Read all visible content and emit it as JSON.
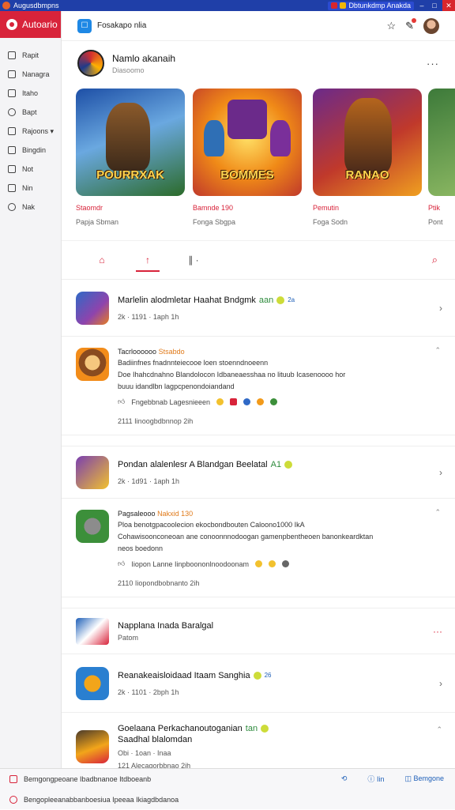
{
  "titlebar": {
    "title": "Augusdbmpns",
    "pill_text": "Dbtunkdmp Anakda"
  },
  "sidebar": {
    "brand": "Autoario",
    "items": [
      {
        "label": "Rapit",
        "icon": "square-icon"
      },
      {
        "label": "Nanagra",
        "icon": "inbox-icon"
      },
      {
        "label": "Itaho",
        "icon": "list-icon"
      },
      {
        "label": "Bapt",
        "icon": "tag-icon"
      },
      {
        "label": "Rajoons ▾",
        "icon": "play-icon"
      },
      {
        "label": "Bingdin",
        "icon": "doc-icon"
      },
      {
        "label": "Not",
        "icon": "calendar-icon"
      },
      {
        "label": "Nin",
        "icon": "mail-icon"
      },
      {
        "label": "Nak",
        "icon": "clock-icon"
      }
    ]
  },
  "topbar": {
    "app_name": "Fosakapo nlia"
  },
  "profile": {
    "name": "Namlo akanaih",
    "subtitle": "Diasoomo"
  },
  "carousel": [
    {
      "art_text": "POURRXAK",
      "title": "Staomdr",
      "subtitle": "Papja Sbman",
      "accent": "#1d4fa6"
    },
    {
      "art_text": "BOMMES",
      "title": "Bamnde 190",
      "subtitle": "Fonga Sbgpa",
      "accent": "#f08a17"
    },
    {
      "art_text": "RANAO",
      "title": "Pemutin",
      "subtitle": "Foga Sodn",
      "accent": "#6b2a8a"
    },
    {
      "art_text": "",
      "title": "Ptik",
      "subtitle": "Pont",
      "accent": "#3d7a3a"
    }
  ],
  "tabs": [
    {
      "label": "⌂",
      "icon": "home-icon"
    },
    {
      "label": "↑",
      "icon": "upload-icon"
    },
    {
      "label": "∥ ·",
      "icon": "chart-icon"
    }
  ],
  "rows": [
    {
      "title": "Marlelin alodmletar Haahat Bndgmk",
      "green": "aan",
      "blue": "2a",
      "meta": "2k  ·  1191  ·  1aph    1h",
      "color": "#2f69c6"
    },
    {
      "title": "Pondan alalenlesr A Blandgan Beelatal",
      "green": "A1",
      "blue": "",
      "meta": "2k  ·  1d91  ·  1aph    1h",
      "color": "#7a3fb0"
    }
  ],
  "posts": [
    {
      "head": "Tacrloooooo",
      "tag": "Stsabdo",
      "line1": "Badiinfnes fnadnnteiecooe loen stoenndnoeenn",
      "line2": "Doe Ihahcdnahno Blandolocon Idbaneaesshaa no  lituub  Icasenoooo hor",
      "line3": "buuu idandlbn lagpcpenondoiandand",
      "acts": "Fngebbnab   Lagesnieeen",
      "foot": "2111   Iinoogbdbnnop   2ih",
      "color": "#f28c1a"
    },
    {
      "head": "Pagsaleooo",
      "tag": "Nakxid 130",
      "line1": "Ploa benotgpacoolecion ekocbondbouten Caloono1000 IkA",
      "line2": "Cohawisoonconeoan ane conoonnnodoogan gamenpbentheoen banonkeardktan",
      "line3": "neos boedonn",
      "acts": "Iiopon  Lanne   Iinpboononlnoodoonam",
      "foot": "2110   Iiopondbobnanto   2ih",
      "color": "#3c8f3a"
    }
  ],
  "section": {
    "title": "Napplana Inada Baralgal",
    "subtitle": "Patom"
  },
  "rows2": [
    {
      "title": "Reanakeaisloidaad Itaam Sanghia",
      "green": "",
      "blue": "26",
      "meta": "2k  ·  1101  ·  2bph    1h",
      "color": "#2a7fd0"
    },
    {
      "title": "Goelaana Perkachanoutoganian",
      "green": "tan",
      "blue": "",
      "meta": "Obi  ·  1oan  ·  Inaa",
      "sub": "Saadhal blalomdan",
      "foot": "121   Alecagorbbnao   2ih",
      "color": "#4a3a2a"
    }
  ],
  "status": {
    "line1": "Bemgongpeoane Ibadbnanoe Itdboeanb",
    "line2": "Bengopleeanabbanboesiua Ipeeaa Ikiagdbdanoa",
    "right1": "Iin",
    "right2": "Bemgone"
  }
}
